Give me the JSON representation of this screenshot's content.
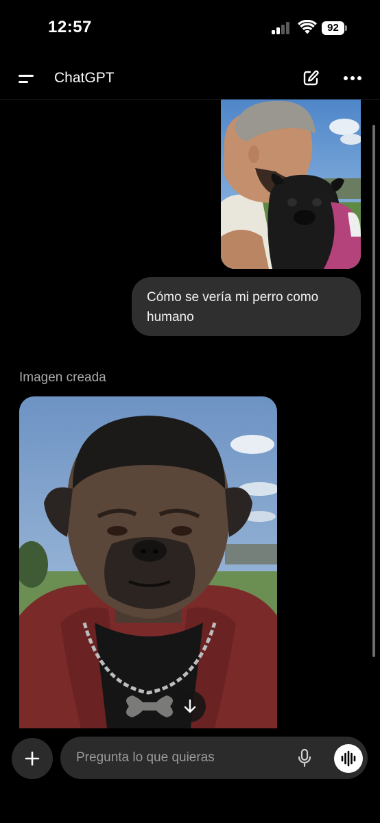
{
  "status_bar": {
    "time": "12:57",
    "battery": "92"
  },
  "header": {
    "title": "ChatGPT"
  },
  "chat": {
    "user_message": "Cómo se vería mi perro como humano",
    "assistant_label": "Imagen creada"
  },
  "composer": {
    "placeholder": "Pregunta lo que quieras"
  },
  "icons": {
    "menu": "menu-icon",
    "new_chat": "edit-icon",
    "more": "more-icon",
    "download": "arrow-down-icon",
    "plus": "plus-icon",
    "mic": "mic-icon",
    "voice": "voice-waveform-icon"
  },
  "colors": {
    "background": "#000000",
    "bubble": "#2f2f2f",
    "input": "#2b2b2b",
    "muted_text": "#a8a8a8"
  }
}
